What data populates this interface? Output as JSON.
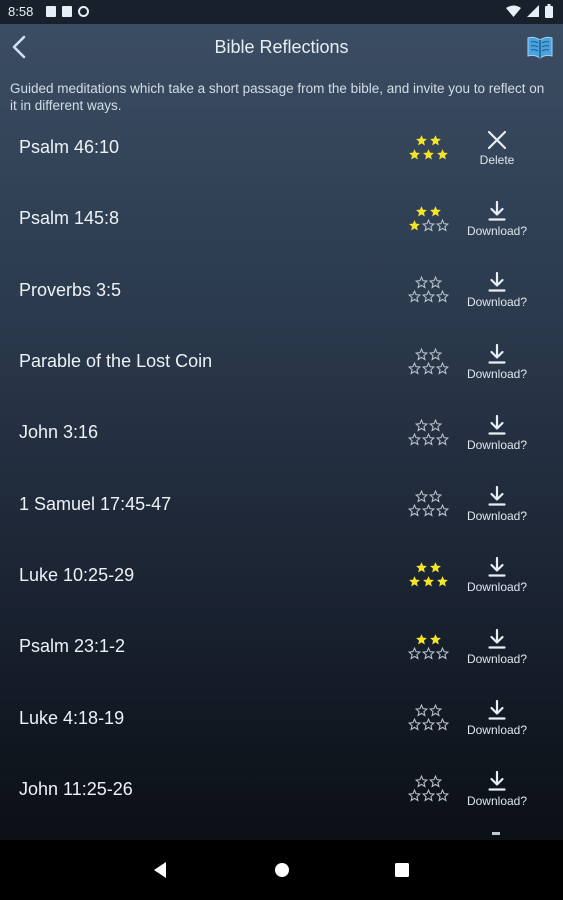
{
  "status_bar": {
    "time": "8:58"
  },
  "app_bar": {
    "title": "Bible Reflections"
  },
  "description": "Guided meditations which take a short passage from the bible, and invite you to reflect on it in different ways.",
  "colors": {
    "star_filled": "#f4e52c",
    "star_empty": "#b9c2cc"
  },
  "items": [
    {
      "title": "Psalm 46:10",
      "filled_stars": 5,
      "action_icon": "close-icon",
      "action_label": "Delete"
    },
    {
      "title": "Psalm 145:8",
      "filled_stars": 3,
      "action_icon": "download-icon",
      "action_label": "Download?"
    },
    {
      "title": "Proverbs 3:5",
      "filled_stars": 0,
      "action_icon": "download-icon",
      "action_label": "Download?"
    },
    {
      "title": "Parable of the Lost Coin",
      "filled_stars": 0,
      "action_icon": "download-icon",
      "action_label": "Download?"
    },
    {
      "title": "John 3:16",
      "filled_stars": 0,
      "action_icon": "download-icon",
      "action_label": "Download?"
    },
    {
      "title": "1 Samuel 17:45-47",
      "filled_stars": 0,
      "action_icon": "download-icon",
      "action_label": "Download?"
    },
    {
      "title": "Luke 10:25-29",
      "filled_stars": 5,
      "action_icon": "download-icon",
      "action_label": "Download?"
    },
    {
      "title": "Psalm 23:1-2",
      "filled_stars": 2,
      "action_icon": "download-icon",
      "action_label": "Download?"
    },
    {
      "title": "Luke 4:18-19",
      "filled_stars": 0,
      "action_icon": "download-icon",
      "action_label": "Download?"
    },
    {
      "title": "John 11:25-26",
      "filled_stars": 0,
      "action_icon": "download-icon",
      "action_label": "Download?"
    }
  ]
}
